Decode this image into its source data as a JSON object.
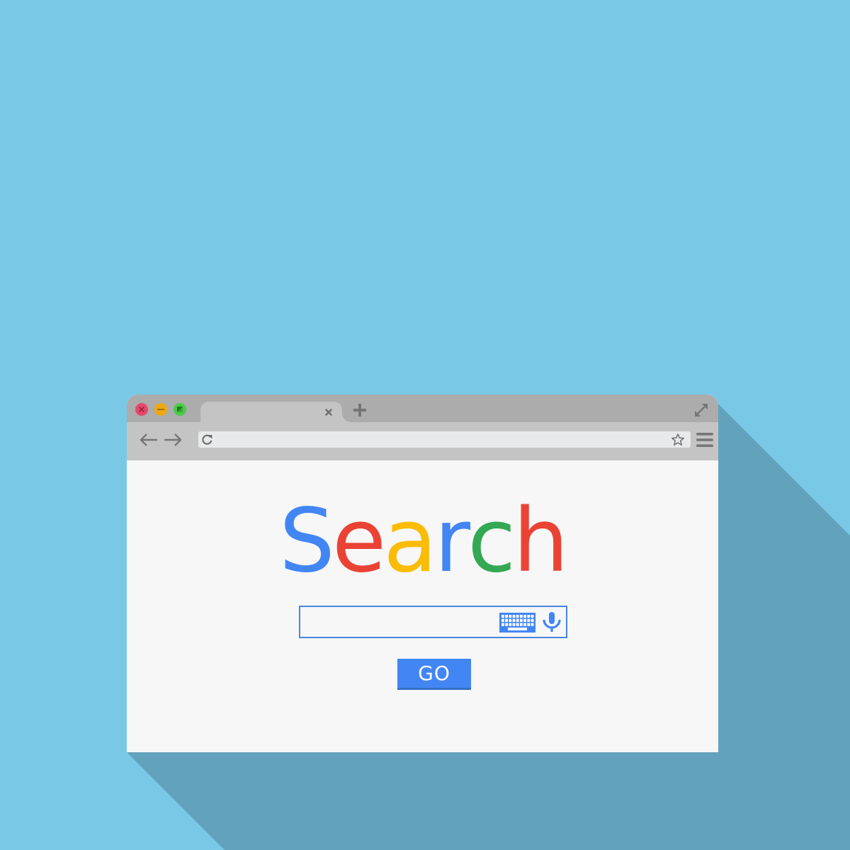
{
  "colors": {
    "background": "#79c9e6",
    "shadow": "#63a2bc",
    "tabbar": "#acacac",
    "toolbar": "#c4c4c4",
    "content": "#f7f7f7",
    "icon_gray": "#767676",
    "accent_blue": "#4286f4"
  },
  "window": {
    "controls": [
      {
        "name": "close",
        "icon": "close-x-icon",
        "color": "#e4496c"
      },
      {
        "name": "minimize",
        "icon": "minus-icon",
        "color": "#eda814"
      },
      {
        "name": "maximize",
        "icon": "maximize-diagonal-icon",
        "color": "#4cc94a"
      }
    ],
    "tab": {
      "title": "",
      "close_icon": "close-icon"
    },
    "new_tab_icon": "plus-icon",
    "resize_icon": "expand-arrows-icon"
  },
  "toolbar": {
    "back_icon": "arrow-left-icon",
    "forward_icon": "arrow-right-icon",
    "reload_icon": "reload-icon",
    "address": {
      "value": "",
      "placeholder": ""
    },
    "bookmark_icon": "star-outline-icon",
    "menu_icon": "hamburger-menu-icon"
  },
  "page": {
    "logo": {
      "letters": [
        {
          "char": "S",
          "color": "#4286f4"
        },
        {
          "char": "e",
          "color": "#ea4335"
        },
        {
          "char": "a",
          "color": "#fbbc05"
        },
        {
          "char": "r",
          "color": "#4286f4"
        },
        {
          "char": "c",
          "color": "#34a853"
        },
        {
          "char": "h",
          "color": "#ea4335"
        }
      ]
    },
    "search": {
      "value": "",
      "placeholder": "",
      "keyboard_icon": "keyboard-icon",
      "mic_icon": "microphone-icon"
    },
    "go_label": "GO"
  }
}
